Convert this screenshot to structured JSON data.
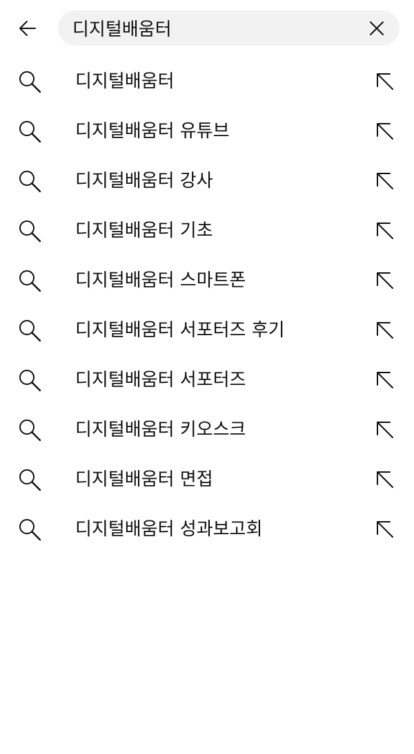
{
  "search": {
    "query": "디지털배움터",
    "back_icon": "arrow-left-icon",
    "clear_icon": "close-icon"
  },
  "suggestions": [
    {
      "text": "디지털배움터",
      "icon": "search-icon",
      "action_icon": "arrow-up-left-icon"
    },
    {
      "text": "디지털배움터 유튜브",
      "icon": "search-icon",
      "action_icon": "arrow-up-left-icon"
    },
    {
      "text": "디지털배움터 강사",
      "icon": "search-icon",
      "action_icon": "arrow-up-left-icon"
    },
    {
      "text": "디지털배움터 기초",
      "icon": "search-icon",
      "action_icon": "arrow-up-left-icon"
    },
    {
      "text": "디지털배움터 스마트폰",
      "icon": "search-icon",
      "action_icon": "arrow-up-left-icon"
    },
    {
      "text": "디지털배움터 서포터즈 후기",
      "icon": "search-icon",
      "action_icon": "arrow-up-left-icon"
    },
    {
      "text": "디지털배움터 서포터즈",
      "icon": "search-icon",
      "action_icon": "arrow-up-left-icon"
    },
    {
      "text": "디지털배움터 키오스크",
      "icon": "search-icon",
      "action_icon": "arrow-up-left-icon"
    },
    {
      "text": "디지털배움터 면접",
      "icon": "search-icon",
      "action_icon": "arrow-up-left-icon"
    },
    {
      "text": "디지털배움터 성과보고회",
      "icon": "search-icon",
      "action_icon": "arrow-up-left-icon"
    }
  ],
  "colors": {
    "text": "#0f0f0f",
    "search_box_bg": "#f2f2f2",
    "background": "#ffffff"
  }
}
